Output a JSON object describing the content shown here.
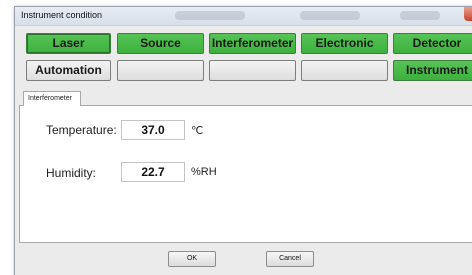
{
  "window": {
    "title": "Instrument condition",
    "close_glyph": "x"
  },
  "buttons": {
    "row1": [
      {
        "label": "Laser",
        "color": "#4cbb4c",
        "selected": true
      },
      {
        "label": "Source",
        "color": "#4cbb4c",
        "selected": false
      },
      {
        "label": "Interferometer",
        "color": "#4cbb4c",
        "selected": false
      },
      {
        "label": "Electronic",
        "color": "#4cbb4c",
        "selected": false
      },
      {
        "label": "Detector",
        "color": "#4cbb4c",
        "selected": false
      }
    ],
    "row2": [
      {
        "label": "Automation",
        "color": "#e4e4e4"
      },
      {
        "label": "",
        "color": "#e4e4e4"
      },
      {
        "label": "",
        "color": "#e4e4e4"
      },
      {
        "label": "",
        "color": "#e4e4e4"
      },
      {
        "label": "Instrument",
        "color": "#4cbb4c"
      }
    ]
  },
  "tab": {
    "label": "Interferometer"
  },
  "fields": {
    "temperature": {
      "label": "Temperature:",
      "value": "37.0",
      "unit": "℃"
    },
    "humidity": {
      "label": "Humidity:",
      "value": "22.7",
      "unit": "%RH"
    }
  },
  "footer": {
    "ok_label": "OK",
    "cancel_label": "Cancel"
  }
}
